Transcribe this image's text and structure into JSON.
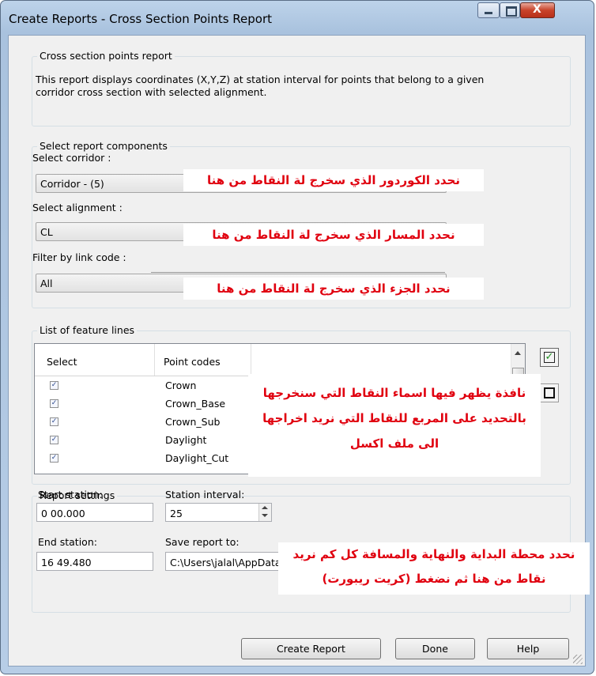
{
  "window": {
    "title": "Create Reports - Cross Section Points Report",
    "minimize_glyph": "–",
    "maximize_glyph": "□",
    "close_glyph": "X"
  },
  "description": {
    "group_label": "Cross section points report",
    "text_line1": "This report displays coordinates (X,Y,Z) at station interval for points that belong to a given",
    "text_line2": "corridor cross section with selected alignment."
  },
  "components": {
    "group_label": "Select report components",
    "corridor_label": "Select corridor :",
    "corridor_value": "Corridor - (5)",
    "alignment_label": "Select alignment :",
    "alignment_value": "CL",
    "linkcode_label": "Filter by link code :",
    "linkcode_value": "All"
  },
  "feature_lines": {
    "group_label": "List of feature lines",
    "columns": [
      "Select",
      "Point codes"
    ],
    "rows": [
      {
        "code": "Crown",
        "checked": true
      },
      {
        "code": "Crown_Base",
        "checked": true
      },
      {
        "code": "Crown_Sub",
        "checked": true
      },
      {
        "code": "Daylight",
        "checked": true
      },
      {
        "code": "Daylight_Cut",
        "checked": true
      }
    ]
  },
  "settings": {
    "group_label": "Report settings",
    "start_label": "Start station:",
    "start_value": "0 00.000",
    "interval_label": "Station interval:",
    "interval_value": "25",
    "end_label": "End station:",
    "end_value": "16 49.480",
    "save_label": "Save report to:",
    "save_value": "C:\\Users\\jalal\\AppData\\Local\\Temp\\civilreport."
  },
  "buttons": {
    "create": "Create Report",
    "done": "Done",
    "help": "Help"
  },
  "annotations": {
    "corridor": "نحدد الكوردور الذي سخرج لة النقاط من هنا",
    "alignment": "نحدد المسار الذي سخرج لة النقاط من هنا",
    "linkcode": "نحدد الجزء الذي سخرج لة النقاط من هنا",
    "list_line1": "نافذة يظهر فيها اسماء النقاط التي سنخرجها",
    "list_line2": "بالتحديد على المربع للنقاط التي نريد اخراجها",
    "list_line3": "الى ملف اكسل",
    "settings_line1": "نحدد محطة البداية والنهاية والمسافة كل كم نريد",
    "settings_line2": "نقاط من هنا ثم نضغط (كريت ريبورت)"
  },
  "colors": {
    "annotation_text": "#e0000f",
    "check_green": "#1f8f1f"
  }
}
